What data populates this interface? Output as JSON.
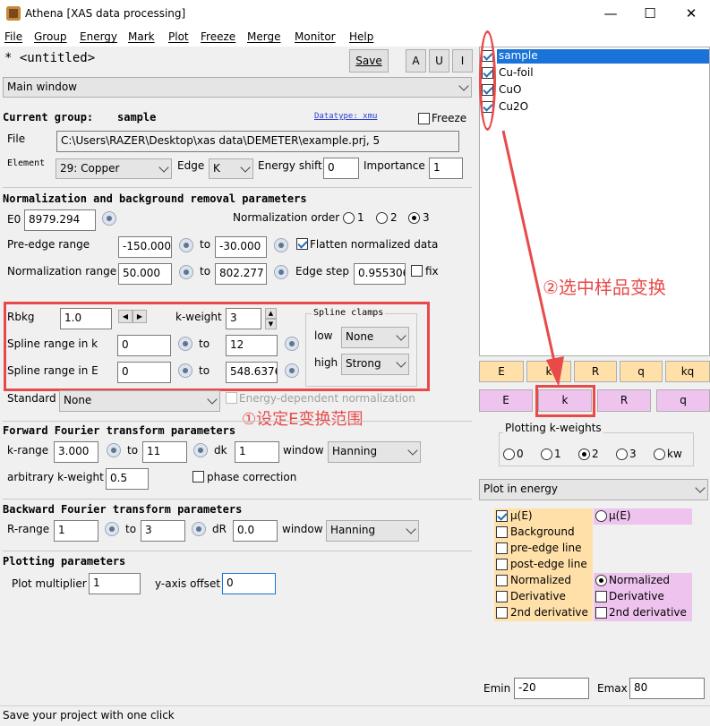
{
  "window": {
    "title": "Athena [XAS data processing]"
  },
  "menu": [
    "File",
    "Group",
    "Energy",
    "Mark",
    "Plot",
    "Freeze",
    "Merge",
    "Monitor",
    "Help"
  ],
  "project": {
    "name": "* <untitled>",
    "save_label": "Save",
    "a_label": "A",
    "u_label": "U",
    "i_label": "I"
  },
  "view_select": "Main window",
  "current_group": {
    "label": "Current group:",
    "name": "sample",
    "datatype": "Datatype: xmu",
    "freeze": "Freeze"
  },
  "file": {
    "label": "File",
    "value": "C:\\Users\\RAZER\\Desktop\\xas data\\DEMETER\\example.prj, 5"
  },
  "element": {
    "label": "Element",
    "value": "29: Copper",
    "edge_label": "Edge",
    "edge_value": "K",
    "shift_label": "Energy shift",
    "shift_value": "0",
    "importance_label": "Importance",
    "importance_value": "1"
  },
  "norm": {
    "header": "Normalization and background removal parameters",
    "e0_label": "E0",
    "e0": "8979.294",
    "order_label": "Normalization order",
    "order1": "1",
    "order2": "2",
    "order3": "3",
    "pre_label": "Pre-edge range",
    "pre_from": "-150.000",
    "to": "to",
    "pre_to": "-30.000",
    "flatten": "Flatten normalized data",
    "nr_label": "Normalization range",
    "nr_from": "50.000",
    "nr_to": "802.277",
    "step_label": "Edge step",
    "step": "0.955306",
    "fix": "fix"
  },
  "spline": {
    "rbkg_label": "Rbkg",
    "rbkg": "1.0",
    "kw_label": "k-weight",
    "kw": "3",
    "k_label": "Spline range in k",
    "k_from": "0",
    "k_to": "12",
    "e_label": "Spline range in E",
    "e_from": "0",
    "e_to": "548.6376",
    "clamps_title": "Spline clamps",
    "low_label": "low",
    "low": "None",
    "high_label": "high",
    "high": "Strong"
  },
  "standard": {
    "label": "Standard",
    "value": "None",
    "edn": "Energy-dependent normalization"
  },
  "annotation1": "①设定E变换范围",
  "annotation2": "②选中样品变换",
  "fft": {
    "header": "Forward Fourier transform parameters",
    "krange_label": "k-range",
    "k_from": "3.000",
    "to": "to",
    "k_to": "11",
    "dk_label": "dk",
    "dk": "1",
    "window_label": "window",
    "window": "Hanning",
    "akw_label": "arbitrary k-weight",
    "akw": "0.5",
    "phase": "phase correction"
  },
  "bft": {
    "header": "Backward Fourier transform parameters",
    "rrange_label": "R-range",
    "r_from": "1",
    "to": "to",
    "r_to": "3",
    "dr_label": "dR",
    "dr": "0.0",
    "window_label": "window",
    "window": "Hanning"
  },
  "plotting": {
    "header": "Plotting parameters",
    "mult_label": "Plot multiplier",
    "mult": "1",
    "offset_label": "y-axis offset",
    "offset": "0"
  },
  "groups": [
    {
      "name": "sample",
      "selected": true
    },
    {
      "name": "Cu-foil",
      "selected": false
    },
    {
      "name": "CuO",
      "selected": false
    },
    {
      "name": "Cu2O",
      "selected": false
    }
  ],
  "plot_buttons_row1": [
    "E",
    "k",
    "R",
    "q",
    "kq"
  ],
  "plot_buttons_row2": [
    "E",
    "k",
    "R",
    "q"
  ],
  "kweights": {
    "title": "Plotting k-weights",
    "options": [
      "0",
      "1",
      "2",
      "3",
      "kw"
    ],
    "selected": "2"
  },
  "plot_mode": "Plot in energy",
  "plot_options": {
    "left": [
      "μ(E)",
      "Background",
      "pre-edge line",
      "post-edge line",
      "Normalized",
      "Derivative",
      "2nd derivative"
    ],
    "right_mu": "μ(E)",
    "right_norm": "Normalized",
    "right_deriv": "Derivative",
    "right_2nd": "2nd derivative"
  },
  "range": {
    "emin_label": "Emin",
    "emin": "-20",
    "emax_label": "Emax",
    "emax": "80"
  },
  "status": "Save your project with one click",
  "colors": {
    "orange": "#ffe0a8",
    "pink": "#eec4ee",
    "annotation": "#e84a4a",
    "selection": "#1a73d9"
  }
}
